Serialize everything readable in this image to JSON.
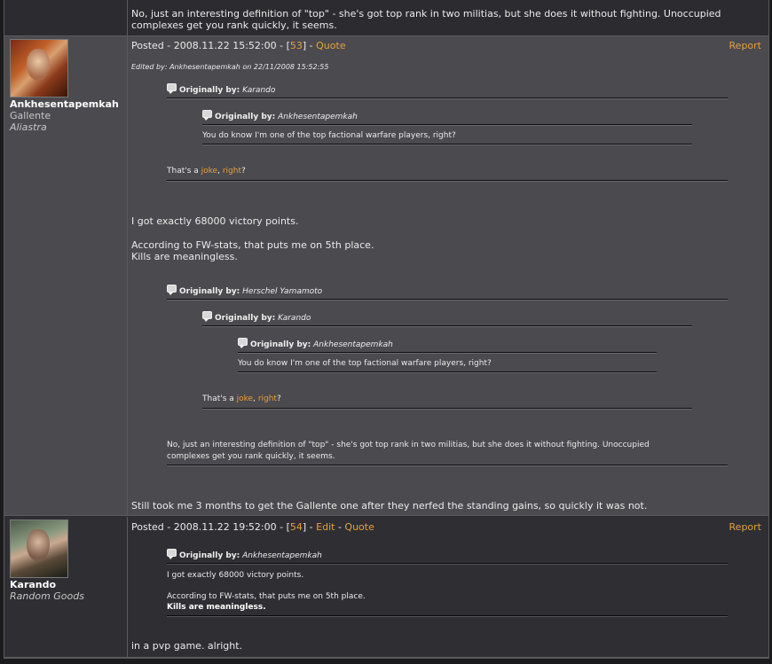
{
  "top_post": {
    "text_line1": "No, just an interesting definition of \"top\" - she's got top rank in two militias, but she does it without fighting. Unoccupied",
    "text_line2": "complexes get you rank quickly, it seems."
  },
  "post1": {
    "author": "Ankhesentapemkah",
    "race": "Gallente",
    "corp": "Aliastra",
    "posted_prefix": "Posted - 2008.11.22 15:52:00 - [",
    "post_number": "53",
    "posted_suffix": "] - ",
    "quote_link": "Quote",
    "report_link": "Report",
    "edited_by": "Edited by: Ankhesentapemkah on 22/11/2008 15:52:55",
    "q1_label": "Originally by:",
    "q1_author": "Karando",
    "q1_inner_label": "Originally by:",
    "q1_inner_author": "Ankhesentapemkah",
    "q1_inner_text": "You do know I'm one of the top factional warfare players, right?",
    "q1_text_prefix": "That's a ",
    "q1_link_joke": "joke",
    "q1_text_comma": ", ",
    "q1_link_right": "right",
    "q1_text_suffix": "?",
    "body_line1": "I got exactly 68000 victory points.",
    "body_line2": "According to FW-stats, that puts me on 5th place.",
    "body_line3": "Kills are meaningless.",
    "q2_label": "Originally by:",
    "q2_author": "Herschel Yamamoto",
    "q2_mid_label": "Originally by:",
    "q2_mid_author": "Karando",
    "q2_inner_label": "Originally by:",
    "q2_inner_author": "Ankhesentapemkah",
    "q2_inner_text": "You do know I'm one of the top factional warfare players, right?",
    "q2_mid_prefix": "That's a ",
    "q2_mid_joke": "joke",
    "q2_mid_comma": ", ",
    "q2_mid_right": "right",
    "q2_mid_suffix": "?",
    "q2_text_line1": "No, just an interesting definition of \"top\" - she's got top rank in two militias, but she does it without fighting. Unoccupied",
    "q2_text_line2": "complexes get you rank quickly, it seems.",
    "closing": "Still took me 3 months to get the Gallente one after they nerfed the standing gains, so quickly it was not."
  },
  "post2": {
    "author": "Karando",
    "corp": "Random Goods",
    "posted_prefix": "Posted - 2008.11.22 19:52:00 - [",
    "post_number": "54",
    "posted_suffix": "] - ",
    "edit_link": "Edit",
    "sep": " - ",
    "quote_link": "Quote",
    "report_link": "Report",
    "q_label": "Originally by:",
    "q_author": "Ankhesentapemkah",
    "q_line1": "I got exactly 68000 victory points.",
    "q_line2": "According to FW-stats, that puts me on 5th place.",
    "q_line3": "Kills are meaningless.",
    "body": "in a pvp game. alright."
  },
  "colors": {
    "link": "#e8a13a",
    "post_bg_light": "#4a4a4f",
    "post_bg_dark": "#2e2e33"
  }
}
